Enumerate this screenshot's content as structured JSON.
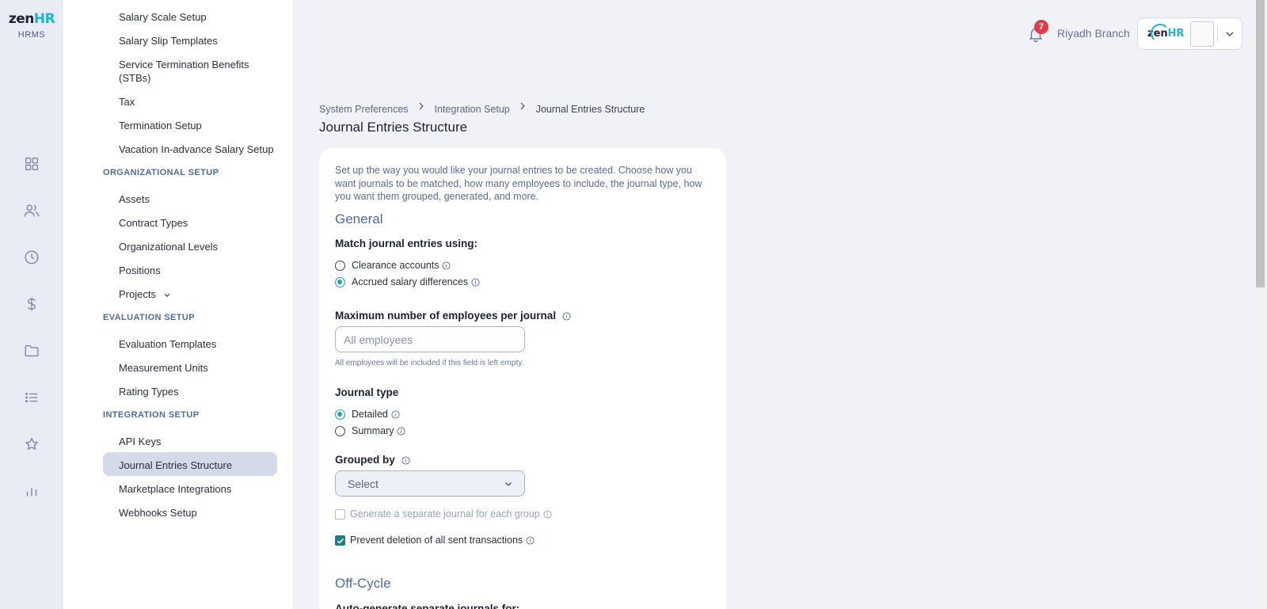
{
  "brand": {
    "logo_zen": "zen",
    "logo_hr": "HR",
    "product": "HRMS"
  },
  "header": {
    "notification_count": "7",
    "branch": "Riyadh Branch",
    "company_logo_zen": "zen",
    "company_logo_hr": "HR"
  },
  "rail_icons": [
    "dashboard-icon",
    "people-icon",
    "clock-icon",
    "dollar-icon",
    "folder-icon",
    "list-icon",
    "star-icon",
    "bar-chart-icon"
  ],
  "sidebar": {
    "payroll_items": [
      "Salary Scale Setup",
      "Salary Slip Templates",
      "Service Termination Benefits (STBs)",
      "Tax",
      "Termination Setup",
      "Vacation In-advance Salary Setup"
    ],
    "organizational_heading": "ORGANIZATIONAL SETUP",
    "organizational_items": [
      "Assets",
      "Contract Types",
      "Organizational Levels",
      "Positions",
      "Projects"
    ],
    "evaluation_heading": "EVALUATION SETUP",
    "evaluation_items": [
      "Evaluation Templates",
      "Measurement Units",
      "Rating Types"
    ],
    "integration_heading": "INTEGRATION SETUP",
    "integration_items": [
      "API Keys",
      "Journal Entries Structure",
      "Marketplace Integrations",
      "Webhooks Setup"
    ],
    "active_item": "Journal Entries Structure"
  },
  "breadcrumb": [
    "System Preferences",
    "Integration Setup",
    "Journal Entries Structure"
  ],
  "page_title": "Journal Entries Structure",
  "form": {
    "intro": "Set up the way you would like your journal entries to be created. Choose how you want journals to be matched, how many employees to include, the journal type, how you want them grouped, generated, and more.",
    "general_heading": "General",
    "match_label": "Match journal entries using:",
    "match_options": [
      "Clearance accounts",
      "Accrued salary differences"
    ],
    "match_selected": "Accrued salary differences",
    "max_employees_label": "Maximum number of employees per journal",
    "max_employees_placeholder": "All employees",
    "max_employees_hint": "All employees will be included if this field is left empty.",
    "journal_type_label": "Journal type",
    "journal_type_options": [
      "Detailed",
      "Summary"
    ],
    "journal_type_selected": "Detailed",
    "grouped_by_label": "Grouped by",
    "grouped_by_value": "Select",
    "separate_journal_label": "Generate a separate journal for each group",
    "separate_journal_checked": false,
    "prevent_deletion_label": "Prevent deletion of all sent transactions",
    "prevent_deletion_checked": true,
    "offcycle_heading": "Off-Cycle",
    "auto_generate_label": "Auto-generate separate journals for:"
  },
  "colors": {
    "accent": "#20a6a8",
    "section_heading": "#4e6a9a",
    "active_bg": "#d5dae9",
    "badge": "#e23b4a"
  }
}
